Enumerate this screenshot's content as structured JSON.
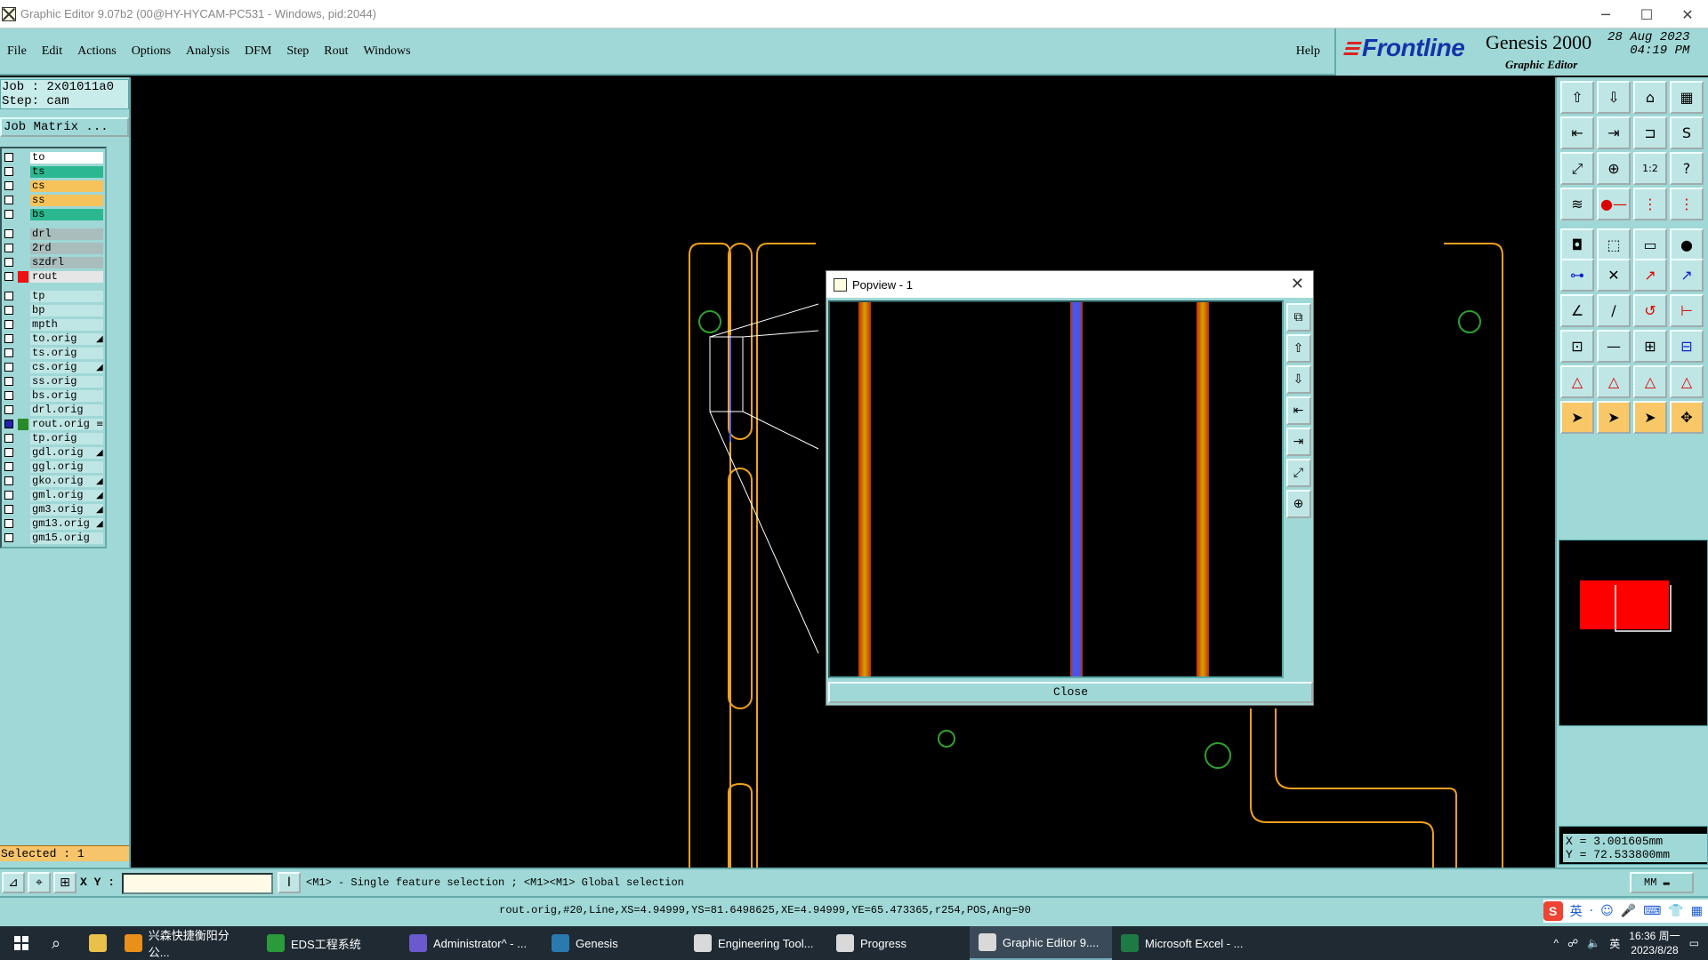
{
  "window": {
    "title": "Graphic Editor 9.07b2 (00@HY-HYCAM-PC531 - Windows, pid:2044)",
    "controls": [
      "─",
      "☐",
      "✕"
    ]
  },
  "menu": {
    "items": [
      "File",
      "Edit",
      "Actions",
      "Options",
      "Analysis",
      "DFM",
      "Step",
      "Rout",
      "Windows"
    ],
    "help": "Help"
  },
  "brand": {
    "logo": "Frontline",
    "product": "Genesis 2000",
    "date_line1": "28 Aug 2023",
    "date_line2": "04:19 PM",
    "subtitle": "Graphic Editor"
  },
  "job": {
    "job_line": "Job : 2x01011a0",
    "step_line": "Step: cam",
    "job_matrix": "Job Matrix ..."
  },
  "layers": [
    {
      "name": "to",
      "color": "#ffffff",
      "group": 1
    },
    {
      "name": "ts",
      "color": "#2bb890",
      "group": 1
    },
    {
      "name": "cs",
      "color": "#f5c35a",
      "group": 1
    },
    {
      "name": "ss",
      "color": "#f5c35a",
      "group": 1
    },
    {
      "name": "bs",
      "color": "#2bb890",
      "group": 1
    },
    {
      "name": "drl",
      "color": "#a9bdbd",
      "group": 2
    },
    {
      "name": "2rd",
      "color": "#a9bdbd",
      "group": 2
    },
    {
      "name": "szdrl",
      "color": "#a9bdbd",
      "group": 2
    },
    {
      "name": "rout",
      "color": "#e6e6e6",
      "group": 2,
      "mark": "#ee1111"
    },
    {
      "name": "tp",
      "color": "#bfe6e4",
      "group": 3
    },
    {
      "name": "bp",
      "color": "#bfe6e4",
      "group": 3
    },
    {
      "name": "mpth",
      "color": "#bfe6e4",
      "group": 3
    },
    {
      "name": "to.orig",
      "color": "#bfe6e4",
      "group": 3,
      "flag": "◢"
    },
    {
      "name": "ts.orig",
      "color": "#bfe6e4",
      "group": 3
    },
    {
      "name": "cs.orig",
      "color": "#bfe6e4",
      "group": 3,
      "flag": "◢"
    },
    {
      "name": "ss.orig",
      "color": "#bfe6e4",
      "group": 3
    },
    {
      "name": "bs.orig",
      "color": "#bfe6e4",
      "group": 3
    },
    {
      "name": "drl.orig",
      "color": "#bfe6e4",
      "group": 3
    },
    {
      "name": "rout.orig",
      "color": "#bfe6e4",
      "group": 3,
      "mark": "#2a8a2a",
      "flag": "≡",
      "checked": true
    },
    {
      "name": "tp.orig",
      "color": "#bfe6e4",
      "group": 3
    },
    {
      "name": "gdl.orig",
      "color": "#bfe6e4",
      "group": 3,
      "flag": "◢"
    },
    {
      "name": "ggl.orig",
      "color": "#bfe6e4",
      "group": 3
    },
    {
      "name": "gko.orig",
      "color": "#bfe6e4",
      "group": 3,
      "flag": "◢"
    },
    {
      "name": "gml.orig",
      "color": "#bfe6e4",
      "group": 3,
      "flag": "◢"
    },
    {
      "name": "gm3.orig",
      "color": "#bfe6e4",
      "group": 3,
      "flag": "◢"
    },
    {
      "name": "gm13.orig",
      "color": "#bfe6e4",
      "group": 3,
      "flag": "◢"
    },
    {
      "name": "gm15.orig",
      "color": "#bfe6e4",
      "group": 3
    }
  ],
  "selected": "Selected : 1",
  "toolbar_icons": [
    "⇧",
    "⇩",
    "⌂",
    "▦",
    "⇤",
    "⇥",
    "⊐",
    "S",
    "⤢",
    "⊕",
    "1:2",
    "?",
    "≋",
    "●—",
    "⋮",
    "⋮",
    "◘",
    "⬚",
    "▭",
    "●",
    "⊶",
    "✕",
    "↗",
    "↗",
    "∠",
    "∕",
    "↺",
    "⊢",
    "⊡",
    "—",
    "⊞",
    "⊟",
    "△",
    "△",
    "△",
    "△",
    "➤",
    "➤",
    "➤",
    "✥"
  ],
  "coords": {
    "x": "X = 3.001605mm",
    "y": "Y = 72.533800mm"
  },
  "cmd": {
    "xy_label": "X Y :",
    "xy_value": "",
    "prompt": "<M1> - Single feature selection ; <M1><M1> Global selection",
    "units": "MM"
  },
  "status": "rout.orig,#20,Line,XS=4.94999,YS=81.6498625,XE=4.94999,YE=65.473365,r254,POS,Ang=90",
  "ime": [
    "英",
    "·",
    "☺",
    "🎤",
    "⌨",
    "👕",
    "▦"
  ],
  "popview": {
    "title": "Popview - 1",
    "close_label": "Close",
    "tools": [
      "⧉",
      "⇧",
      "⇩",
      "⇤",
      "⇥",
      "⤢",
      "⊕"
    ]
  },
  "taskbar": {
    "items": [
      {
        "label": "兴森快捷衡阳分公...",
        "color": "#e8901a"
      },
      {
        "label": "EDS工程系统",
        "color": "#2a9a3a"
      },
      {
        "label": "Administrator^ - ...",
        "color": "#6a5acd"
      },
      {
        "label": "Genesis",
        "color": "#2a7ab0"
      },
      {
        "label": "Engineering Tool...",
        "color": "#d9d9d9"
      },
      {
        "label": "Progress",
        "color": "#d9d9d9"
      },
      {
        "label": "Graphic Editor 9....",
        "color": "#d9d9d9",
        "active": true
      },
      {
        "label": "Microsoft Excel - ...",
        "color": "#1e7a45"
      }
    ],
    "time": "16:36 周一",
    "date": "2023/8/28",
    "lang": "英"
  }
}
